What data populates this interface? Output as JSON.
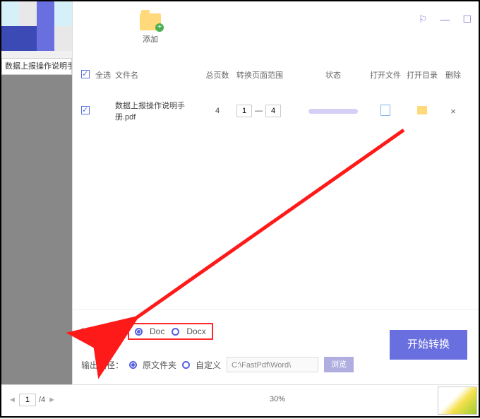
{
  "window": {
    "tab_title": "数据上报操作说明手册.p"
  },
  "toolbar": {
    "add_label": "添加"
  },
  "header": {
    "select_all": "全选",
    "name": "文件名",
    "pages": "总页数",
    "range": "转换页面范围",
    "status": "状态",
    "open_file": "打开文件",
    "open_dir": "打开目录",
    "delete": "删除"
  },
  "rows": [
    {
      "name": "数据上报操作说明手册.pdf",
      "pages": "4",
      "range_from": "1",
      "range_to": "4"
    }
  ],
  "format": {
    "label": "转化格式：",
    "opt_doc": "Doc",
    "opt_docx": "Docx"
  },
  "output": {
    "label": "输出路径：",
    "opt_source": "原文件夹",
    "opt_custom": "自定义",
    "path": "C:\\FastPdf\\Word\\",
    "browse": "浏览"
  },
  "start_btn": "开始转换",
  "status_bar": {
    "page_current": "1",
    "page_total": "/4",
    "zoom": "30%"
  },
  "tiles": [
    "#d6f0f9",
    "#e8e8e8",
    "#6a6fe0",
    "#d6f0f9",
    "#3b4ab5",
    "#3b4ab5",
    "#6a6fe0",
    "#e8e8e8"
  ]
}
